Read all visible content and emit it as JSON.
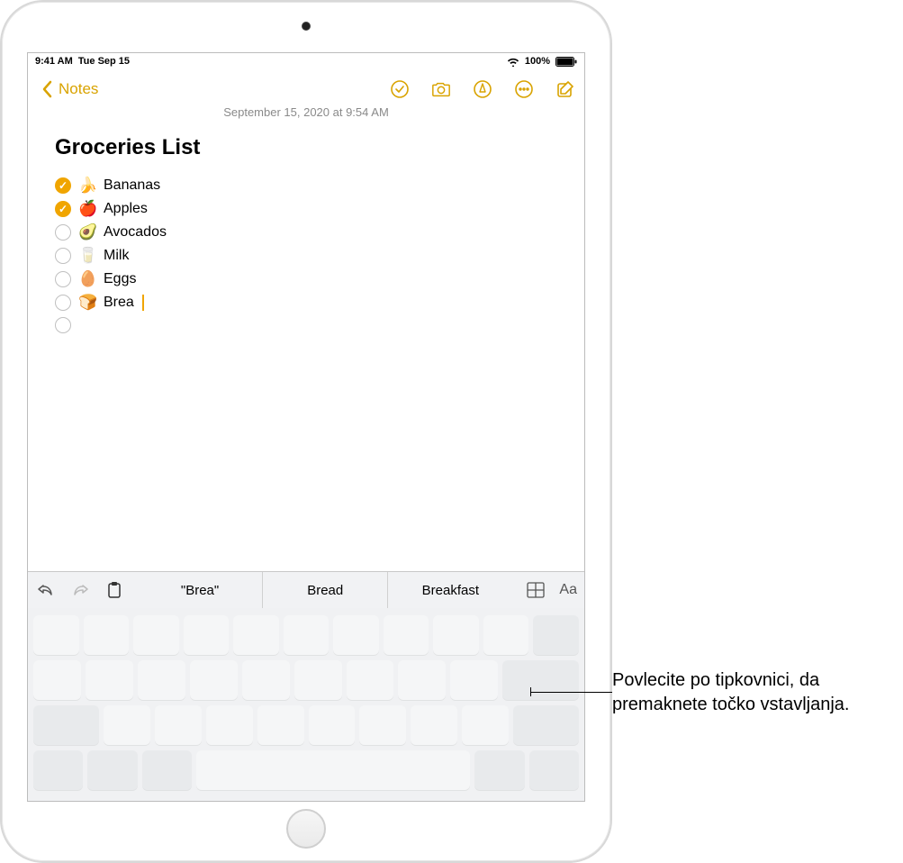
{
  "status": {
    "time": "9:41 AM",
    "date": "Tue Sep 15",
    "battery_text": "100%"
  },
  "nav": {
    "back_label": "Notes"
  },
  "note": {
    "timestamp": "September 15, 2020 at 9:54 AM",
    "title": "Groceries List",
    "items": [
      {
        "checked": true,
        "emoji": "🍌",
        "label": "Bananas"
      },
      {
        "checked": true,
        "emoji": "🍎",
        "label": "Apples"
      },
      {
        "checked": false,
        "emoji": "🥑",
        "label": "Avocados"
      },
      {
        "checked": false,
        "emoji": "🥛",
        "label": "Milk"
      },
      {
        "checked": false,
        "emoji": "🥚",
        "label": "Eggs"
      },
      {
        "checked": false,
        "emoji": "🍞",
        "label": "Brea",
        "caret": true
      },
      {
        "checked": false,
        "emoji": "",
        "label": ""
      }
    ]
  },
  "keyboard": {
    "suggestions": [
      "\"Brea\"",
      "Bread",
      "Breakfast"
    ],
    "format_label": "Aa"
  },
  "callout": {
    "text": "Povlecite po tipkovnici, da premaknete točko vstavljanja."
  }
}
